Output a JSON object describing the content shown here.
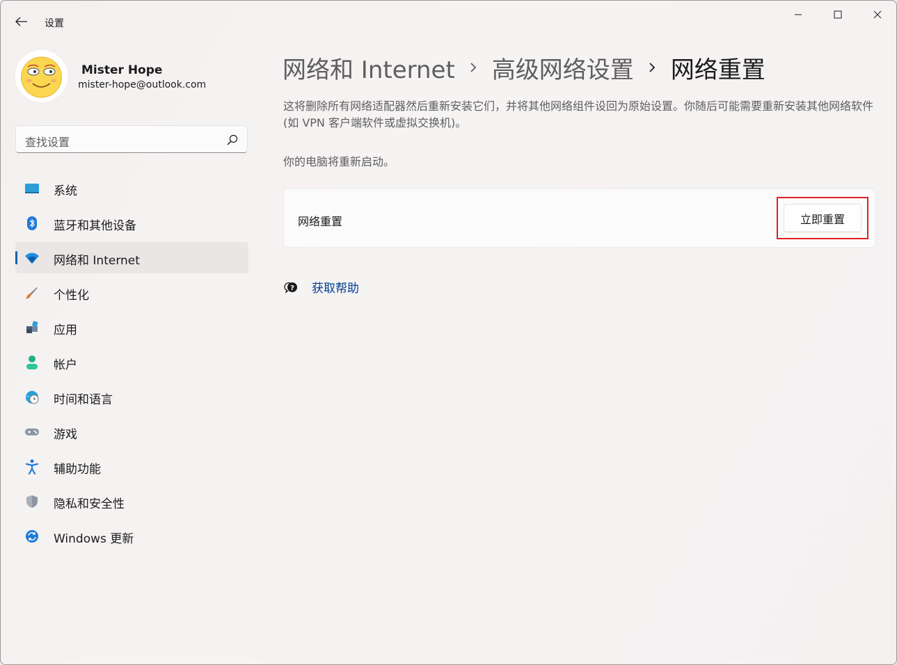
{
  "window": {
    "app_title": "设置"
  },
  "profile": {
    "name": "Mister Hope",
    "email": "mister-hope@outlook.com"
  },
  "search": {
    "placeholder": "查找设置"
  },
  "sidebar": {
    "items": [
      {
        "label": "系统",
        "icon": "system-icon"
      },
      {
        "label": "蓝牙和其他设备",
        "icon": "bluetooth-icon"
      },
      {
        "label": "网络和 Internet",
        "icon": "wifi-icon",
        "active": true
      },
      {
        "label": "个性化",
        "icon": "brush-icon"
      },
      {
        "label": "应用",
        "icon": "apps-icon"
      },
      {
        "label": "帐户",
        "icon": "account-icon"
      },
      {
        "label": "时间和语言",
        "icon": "globe-clock-icon"
      },
      {
        "label": "游戏",
        "icon": "gamepad-icon"
      },
      {
        "label": "辅助功能",
        "icon": "accessibility-icon"
      },
      {
        "label": "隐私和安全性",
        "icon": "shield-icon"
      },
      {
        "label": "Windows 更新",
        "icon": "update-icon"
      }
    ]
  },
  "breadcrumb": {
    "items": [
      "网络和 Internet",
      "高级网络设置",
      "网络重置"
    ]
  },
  "main": {
    "description": "这将删除所有网络适配器然后重新安装它们，并将其他网络组件设回为原始设置。你随后可能需要重新安装其他网络软件(如 VPN 客户端软件或虚拟交换机)。",
    "restart_note": "你的电脑将重新启动。",
    "card_label": "网络重置",
    "reset_button": "立即重置",
    "help_link": "获取帮助"
  },
  "colors": {
    "accent": "#0063b1",
    "link": "#003e92",
    "highlight": "#e02020"
  }
}
